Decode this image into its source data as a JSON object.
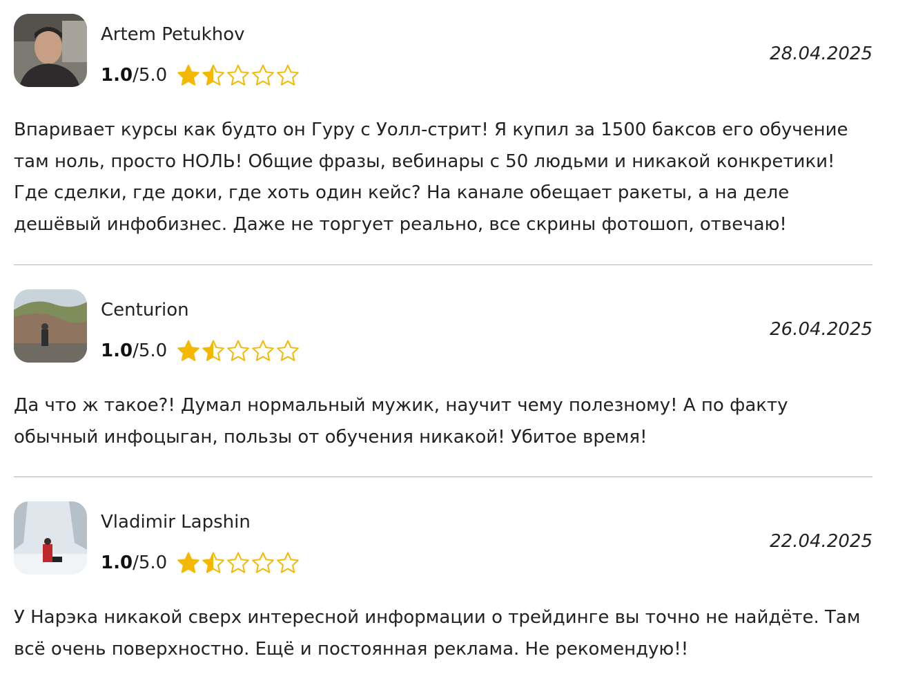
{
  "reviews": [
    {
      "author": "Artem Petukhov",
      "score": "1.0",
      "max": "/5.0",
      "rating": 1.5,
      "date": "28.04.2025",
      "text": "Впаривает курсы как будто он Гуру с Уолл-стрит! Я купил за 1500 баксов его обучение там ноль, просто НОЛЬ! Общие фразы, вебинары с 50 людьми и никакой конкретики! Где сделки, где доки, где хоть один кейс? На канале обещает ракеты, а на деле дешёвый инфобизнес. Даже не торгует реально, все скрины фотошоп, отвечаю!"
    },
    {
      "author": "Centurion",
      "score": "1.0",
      "max": "/5.0",
      "rating": 1.5,
      "date": "26.04.2025",
      "text": "Да что ж такое?! Думал нормальный мужик, научит чему полезному! А по факту обычный инфоцыган, пользы от обучения никакой! Убитое время!"
    },
    {
      "author": "Vladimir Lapshin",
      "score": "1.0",
      "max": "/5.0",
      "rating": 1.5,
      "date": "22.04.2025",
      "text": "У Нарэка никакой сверх интересной информации о трейдинге вы точно не найдёте. Там всё очень поверхностно. Ещё и постоянная реклама. Не рекомендую!!"
    }
  ],
  "colors": {
    "star": "#f5b800",
    "divider": "#b5b5b5"
  }
}
